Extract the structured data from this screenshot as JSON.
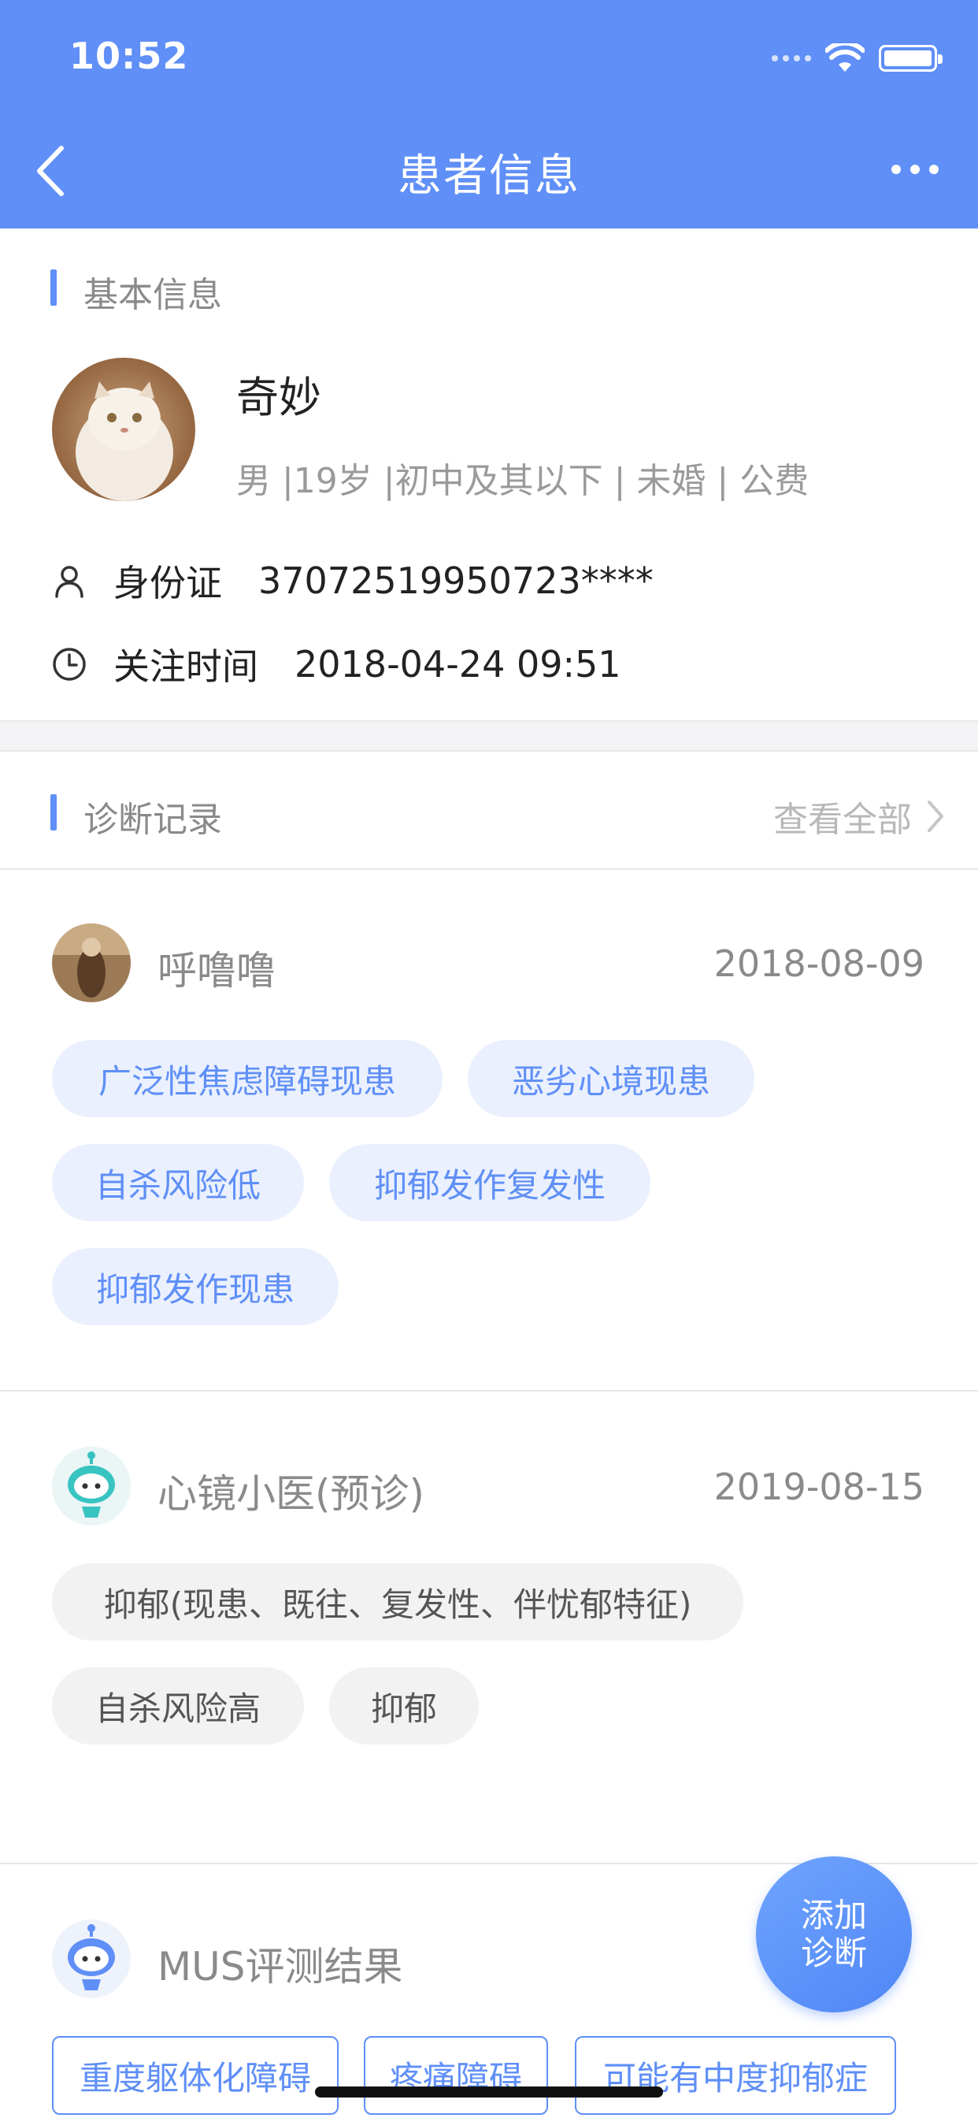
{
  "colors": {
    "accent": "#5f8ff7",
    "tag_blue_bg": "#eaf0fe",
    "tag_gray_bg": "#f2f2f2"
  },
  "status_bar": {
    "time": "10:52"
  },
  "nav": {
    "title": "患者信息",
    "back_icon": "chevron-left-icon",
    "more_icon": "more-dots-icon"
  },
  "basic_info": {
    "section_title": "基本信息",
    "name": "奇妙",
    "meta": "男 |19岁 |初中及其以下 |  未婚  |  公费",
    "id_label": "身份证",
    "id_value": "37072519950723****",
    "follow_label": "关注时间",
    "follow_value": "2018-04-24 09:51"
  },
  "diagnosis": {
    "section_title": "诊断记录",
    "view_all": "查看全部",
    "records": [
      {
        "doctor": "呼噜噜",
        "date": "2018-08-09",
        "tags": [
          "广泛性焦虑障碍现患",
          "恶劣心境现患",
          "自杀风险低",
          "抑郁发作复发性",
          "抑郁发作现患"
        ]
      },
      {
        "doctor": "心镜小医(预诊)",
        "date": "2019-08-15",
        "tags": [
          "抑郁(现患、既往、复发性、伴忧郁特征)",
          "自杀风险高",
          "抑郁"
        ]
      },
      {
        "doctor": "MUS评测结果",
        "tags": [
          "重度躯体化障碍",
          "疼痛障碍",
          "可能有中度抑郁症"
        ]
      }
    ]
  },
  "fab": {
    "line1": "添加",
    "line2": "诊断"
  }
}
